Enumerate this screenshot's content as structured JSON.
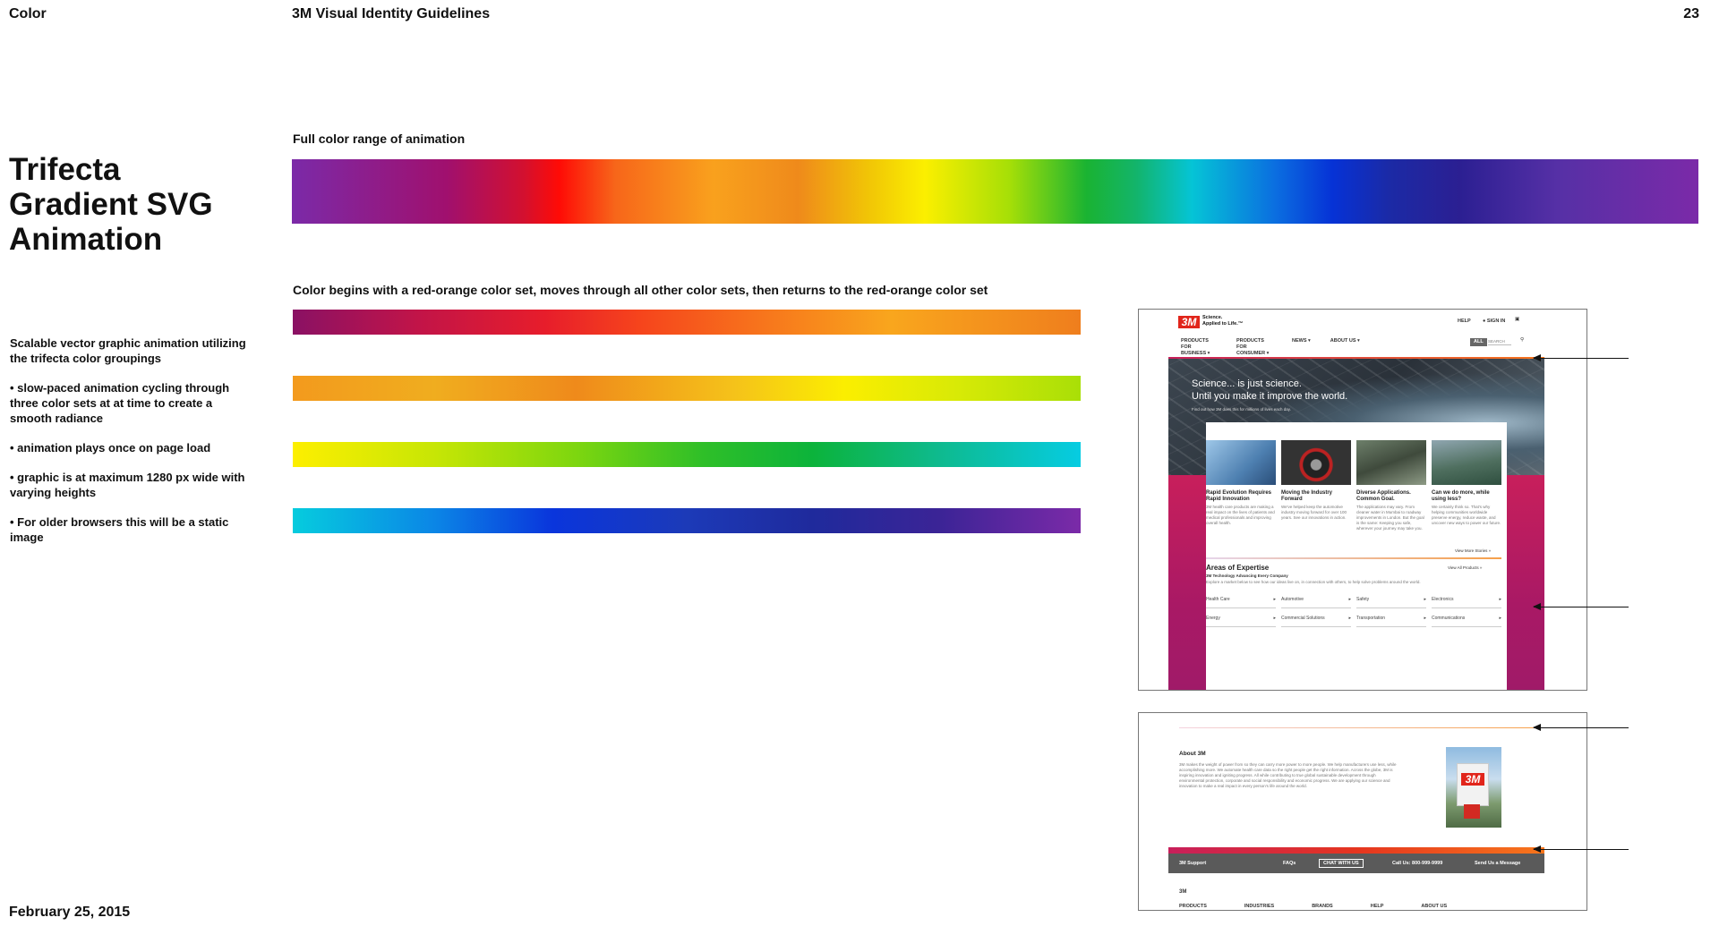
{
  "header": {
    "section": "Color",
    "doc_title": "3M Visual Identity Guidelines",
    "page_number": "23"
  },
  "heading": [
    "Trifecta",
    "Gradient SVG",
    "Animation"
  ],
  "description": [
    "Scalable vector graphic animation utilizing the trifecta color groupings",
    "• slow-paced animation cycling through three color sets at at time to create a smooth radiance",
    "• animation plays once on page load",
    "• graphic is at maximum 1280 px wide with varying heights",
    "• For older browsers this will be a static image"
  ],
  "footer_date": "February 25, 2015",
  "full_range_caption": "Full color range of animation",
  "sequence_caption": "Color begins with a red-orange color set, moves through all other color sets, then returns to the red-orange color set",
  "colors": {
    "purple": "#7b2aa8",
    "magenta": "#a0106e",
    "red": "#ff0b06",
    "orange": "#f9a11d",
    "yellow": "#fbef00",
    "green": "#13b46a",
    "cyan": "#05c4d6",
    "blue": "#0632d6"
  },
  "mockup_top": {
    "tagline_1": "Science.",
    "tagline_2": "Applied to Life.™",
    "util_links": [
      "HELP",
      "SIGN IN"
    ],
    "nav": [
      "PRODUCTS FOR BUSINESS ▾",
      "PRODUCTS FOR CONSUMER ▾",
      "NEWS ▾",
      "ABOUT US ▾"
    ],
    "search_scope": "ALL",
    "search_placeholder": "SEARCH",
    "hero_line_1": "Science... is just science.",
    "hero_line_2": "Until you make it improve the world.",
    "hero_sub": "Find out how 3M does this for millions of lives each day.",
    "stories": [
      {
        "title": "Rapid Evolution Requires Rapid Innovation",
        "text": "3M health care products are making a real impact on the lives of patients and medical professionals and improving overall health."
      },
      {
        "title": "Moving the Industry Forward",
        "text": "We've helped keep the automotive industry moving forward for over 100 years. See our innovations in action."
      },
      {
        "title": "Diverse Applications. Common Goal.",
        "text": "The applications may vary. From cleaner water in Mumbai to roadway improvements in London. But the goal is the same: Keeping you safe, wherever your journey may take you."
      },
      {
        "title": "Can we do more, while using less?",
        "text": "We certainly think so. That's why helping communities worldwide preserve energy, reduce waste, and uncover new ways to power our future."
      }
    ],
    "view_more": "View More Stories »",
    "aoe_title": "Areas of Expertise",
    "aoe_view_all": "View All Products »",
    "aoe_sub": "3M Technology Advancing Every Company",
    "aoe_desc": "Explore a market below to see how our ideas live on, in connection with others, to help solve problems around the world.",
    "aoe_items": [
      "Health Care",
      "Automotive",
      "Safety",
      "Electronics",
      "Energy",
      "Commercial Solutions",
      "Transportation",
      "Communications"
    ]
  },
  "mockup_bottom": {
    "about_title": "About 3M",
    "about_text": "3M makes the weight of power from so they can carry more power to more people. We help manufacturers use less, while accomplishing more. We automate health care data so the right people get the right information. Across the globe, 3M is inspiring innovation and igniting progress. All while contributing to true global sustainable development through environmental protection, corporate and social responsibility and economic progress. We are applying our science and innovation to make a real impact in every person's life around the world.",
    "footer_links": [
      "3M Support",
      "FAQs",
      "CHAT WITH US",
      "Call Us: 800-999-9999",
      "Send Us a Message"
    ],
    "footer_brand": "3M",
    "footer_cols": [
      "PRODUCTS",
      "INDUSTRIES",
      "BRANDS",
      "HELP",
      "ABOUT US"
    ]
  },
  "logo_text": "3M"
}
